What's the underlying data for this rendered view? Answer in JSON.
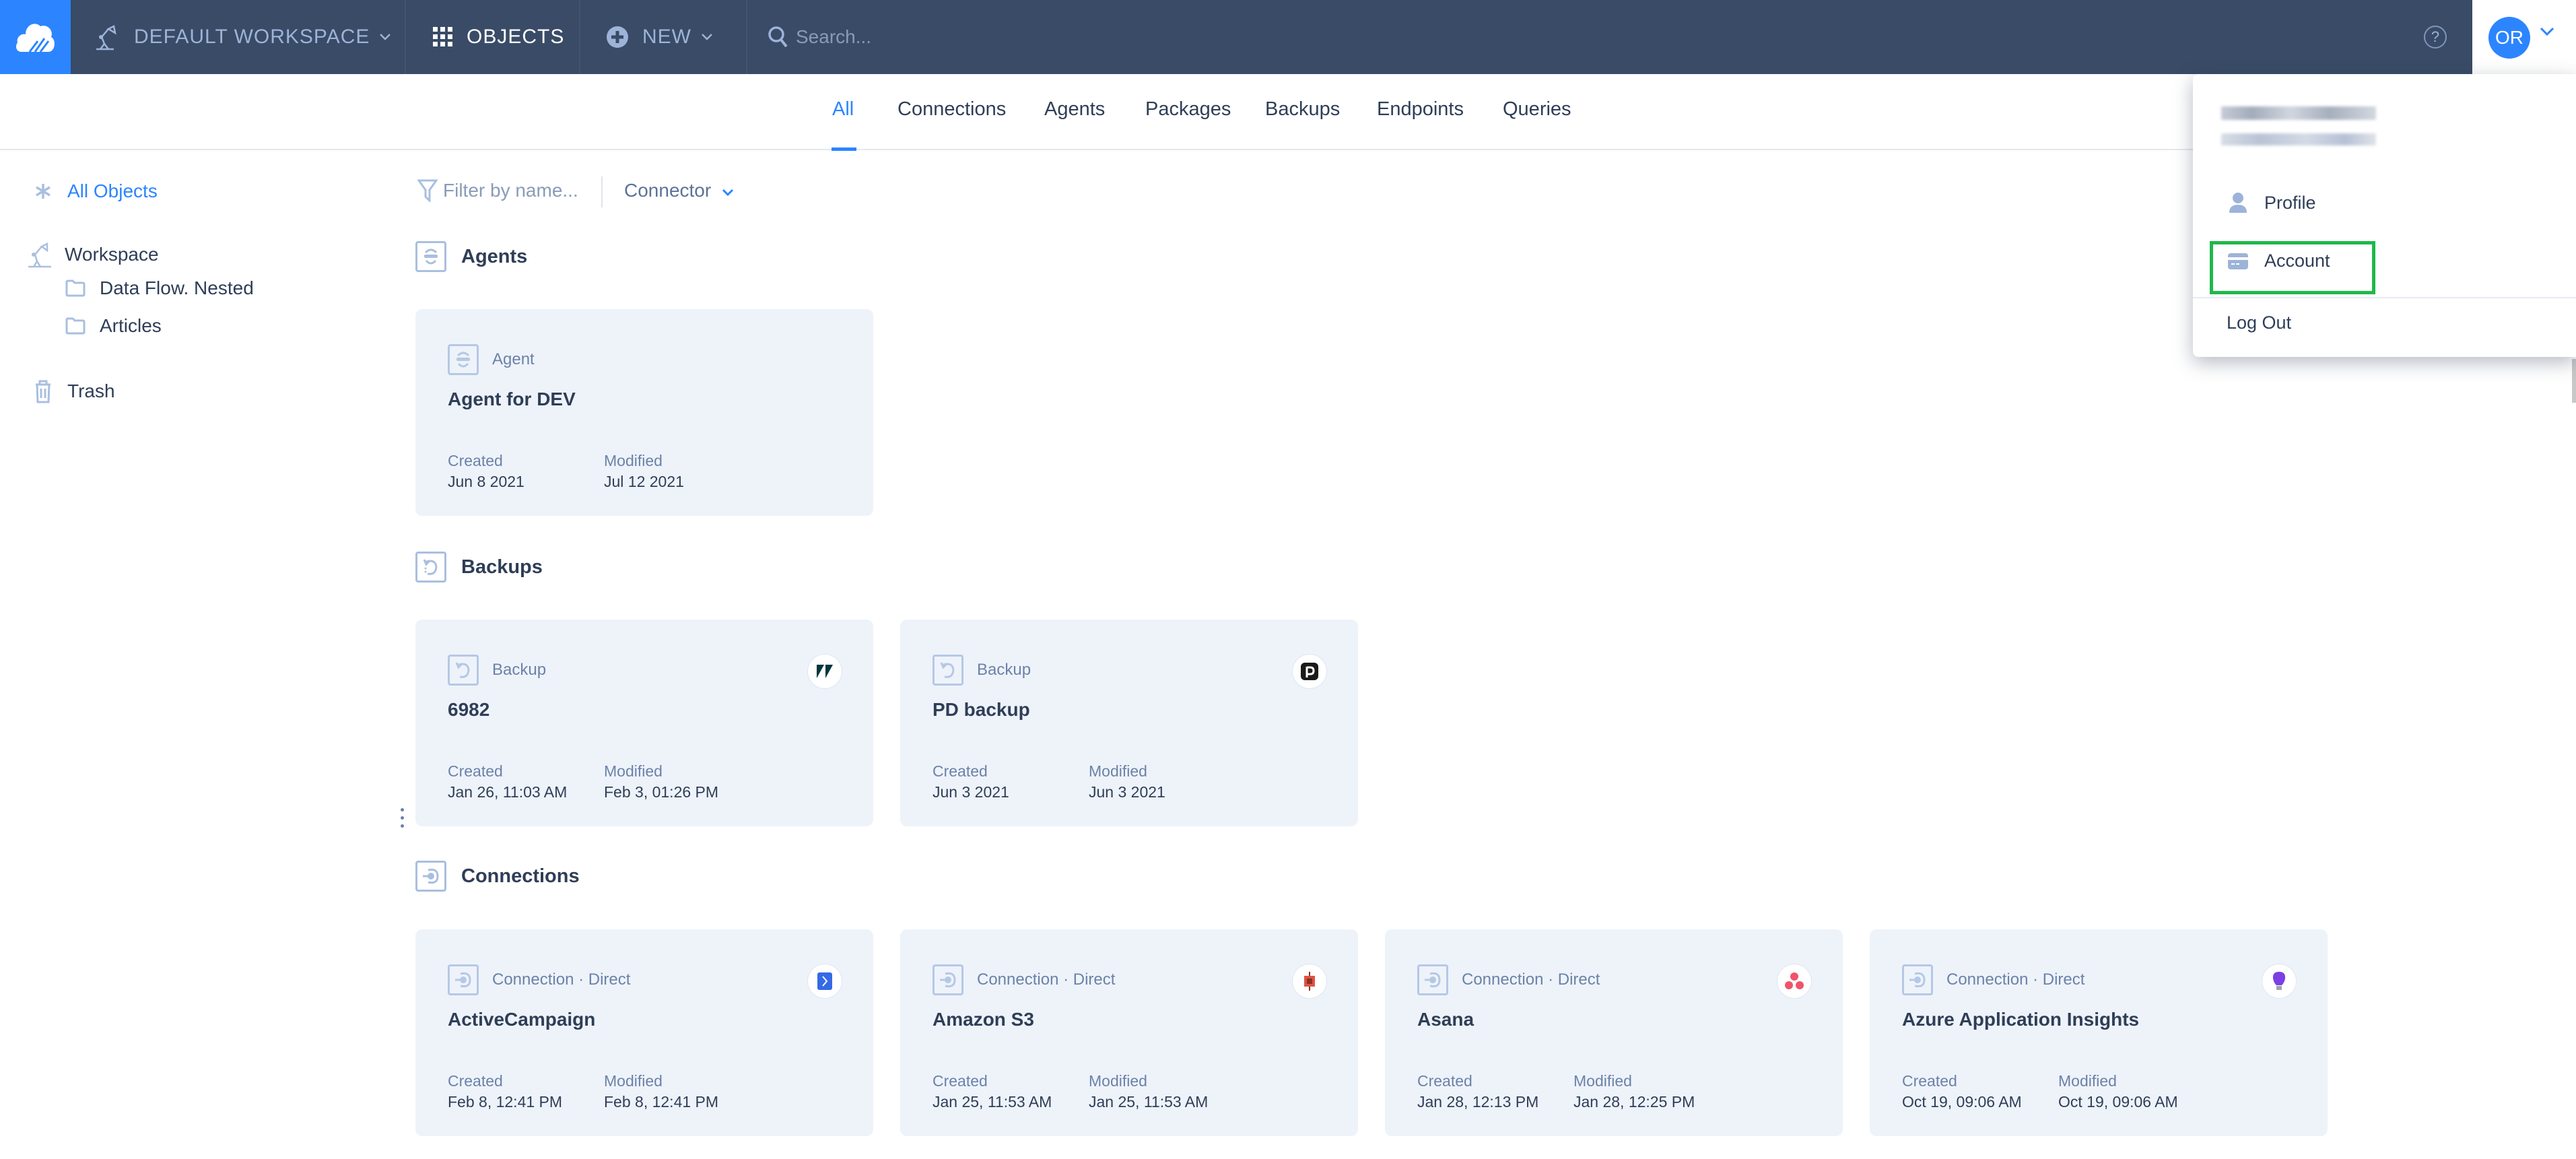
{
  "header": {
    "workspace_label": "DEFAULT WORKSPACE",
    "objects_label": "OBJECTS",
    "new_label": "NEW",
    "search_placeholder": "Search...",
    "help_icon": "?",
    "user_initials": "OR"
  },
  "tabs": [
    {
      "label": "All",
      "active": true
    },
    {
      "label": "Connections"
    },
    {
      "label": "Agents"
    },
    {
      "label": "Packages"
    },
    {
      "label": "Backups"
    },
    {
      "label": "Endpoints"
    },
    {
      "label": "Queries"
    }
  ],
  "sidebar": {
    "items": [
      {
        "label": "All Objects",
        "icon": "asterisk-icon",
        "active": true
      },
      {
        "label": "Workspace",
        "icon": "workspace-lamp-icon"
      },
      {
        "label": "Data Flow. Nested",
        "icon": "folder-icon"
      },
      {
        "label": "Articles",
        "icon": "folder-icon"
      },
      {
        "label": "Trash",
        "icon": "trash-icon"
      }
    ]
  },
  "filters": {
    "name_placeholder": "Filter by name...",
    "connector_label": "Connector"
  },
  "sections": {
    "agents": {
      "title": "Agents",
      "cards": [
        {
          "type": "Agent",
          "name": "Agent for DEV",
          "created_label": "Created",
          "created": "Jun 8 2021",
          "modified_label": "Modified",
          "modified": "Jul 12 2021"
        }
      ]
    },
    "backups": {
      "title": "Backups",
      "cards": [
        {
          "type": "Backup",
          "name": "6982",
          "brand": "zendesk",
          "created_label": "Created",
          "created": "Jan 26, 11:03 AM",
          "modified_label": "Modified",
          "modified": "Feb 3, 01:26 PM"
        },
        {
          "type": "Backup",
          "name": "PD backup",
          "brand": "pipedrive",
          "created_label": "Created",
          "created": "Jun 3 2021",
          "modified_label": "Modified",
          "modified": "Jun 3 2021"
        }
      ]
    },
    "connections": {
      "title": "Connections",
      "cards": [
        {
          "type": "Connection · Direct",
          "name": "ActiveCampaign",
          "brand": "activecampaign",
          "created_label": "Created",
          "created": "Feb 8, 12:41 PM",
          "modified_label": "Modified",
          "modified": "Feb 8, 12:41 PM"
        },
        {
          "type": "Connection · Direct",
          "name": "Amazon S3",
          "brand": "amazon-s3",
          "created_label": "Created",
          "created": "Jan 25, 11:53 AM",
          "modified_label": "Modified",
          "modified": "Jan 25, 11:53 AM"
        },
        {
          "type": "Connection · Direct",
          "name": "Asana",
          "brand": "asana",
          "created_label": "Created",
          "created": "Jan 28, 12:13 PM",
          "modified_label": "Modified",
          "modified": "Jan 28, 12:25 PM"
        },
        {
          "type": "Connection · Direct",
          "name": "Azure Application Insights",
          "brand": "azure-app-insights",
          "created_label": "Created",
          "created": "Oct 19, 09:06 AM",
          "modified_label": "Modified",
          "modified": "Oct 19, 09:06 AM"
        }
      ]
    }
  },
  "user_menu": {
    "items": [
      {
        "label": "Profile",
        "icon": "user-icon"
      },
      {
        "label": "Account",
        "icon": "credit-card-icon",
        "highlighted": true
      }
    ],
    "logout_label": "Log Out"
  },
  "colors": {
    "header_bg": "#394b66",
    "accent": "#2c85ff",
    "card_bg": "#eef3fa",
    "highlight": "#1fb84a"
  }
}
